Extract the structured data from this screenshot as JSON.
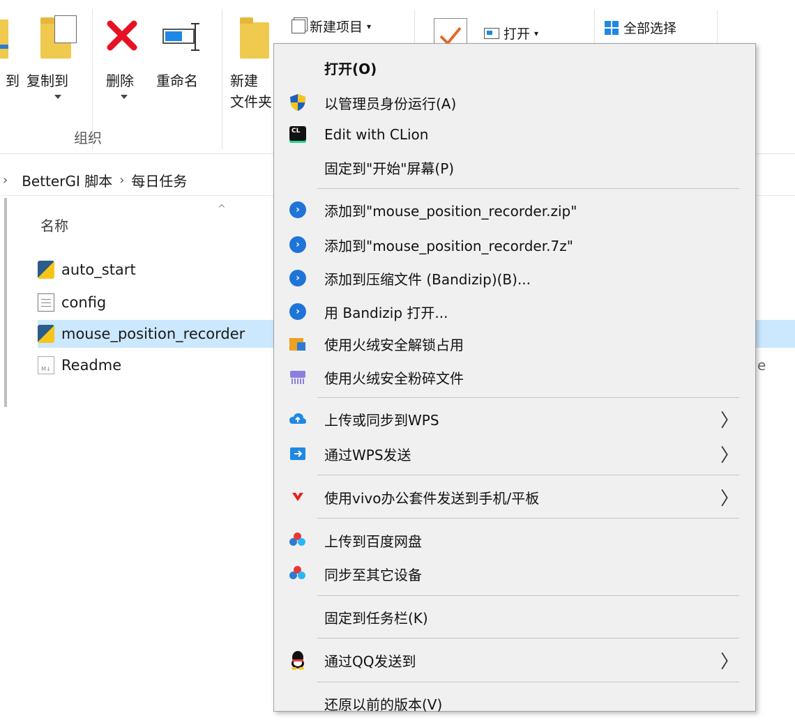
{
  "ribbon": {
    "move_to_partial": "到",
    "copy_to": "复制到",
    "delete": "删除",
    "rename": "重命名",
    "new_folder_line1": "新建",
    "new_folder_line2": "文件夹",
    "new_item": "新建项目",
    "open": "打开",
    "select_all": "全部选择",
    "group_organize": "组织"
  },
  "breadcrumb": {
    "items": [
      "BetterGI 脚本",
      "每日任务"
    ]
  },
  "file_list": {
    "column_name": "名称",
    "files": [
      {
        "name": "auto_start",
        "type": "python"
      },
      {
        "name": "config",
        "type": "text"
      },
      {
        "name": "mouse_position_recorder",
        "type": "python",
        "selected": true
      },
      {
        "name": "Readme",
        "type": "markdown"
      }
    ],
    "readme_type_tail": "e"
  },
  "context_menu": {
    "items": [
      {
        "label": "打开(O)",
        "bold": true,
        "icon": ""
      },
      {
        "label": "以管理员身份运行(A)",
        "icon": "uac-shield-icon"
      },
      {
        "label": "Edit with CLion",
        "icon": "clion-icon"
      },
      {
        "label": "固定到\"开始\"屏幕(P)",
        "icon": ""
      },
      {
        "label": "添加到\"mouse_position_recorder.zip\"",
        "icon": "bandizip-icon"
      },
      {
        "label": "添加到\"mouse_position_recorder.7z\"",
        "icon": "bandizip-icon"
      },
      {
        "label": "添加到压缩文件 (Bandizip)(B)...",
        "icon": "bandizip-icon"
      },
      {
        "label": "用 Bandizip 打开...",
        "icon": "bandizip-icon"
      },
      {
        "label": "使用火绒安全解锁占用",
        "icon": "huorong-unlock-icon"
      },
      {
        "label": "使用火绒安全粉碎文件",
        "icon": "huorong-shred-icon"
      },
      {
        "label": "上传或同步到WPS",
        "icon": "wps-cloud-icon",
        "submenu": true
      },
      {
        "label": "通过WPS发送",
        "icon": "wps-send-icon",
        "submenu": true
      },
      {
        "label": "使用vivo办公套件发送到手机/平板",
        "icon": "vivo-icon",
        "submenu": true
      },
      {
        "label": "上传到百度网盘",
        "icon": "baidu-netdisk-icon"
      },
      {
        "label": "同步至其它设备",
        "icon": "baidu-netdisk-icon"
      },
      {
        "label": "固定到任务栏(K)",
        "icon": ""
      },
      {
        "label": "通过QQ发送到",
        "icon": "qq-icon",
        "submenu": true
      },
      {
        "label": "还原以前的版本(V)",
        "icon": ""
      }
    ],
    "submenu_glyph": "〉"
  },
  "colors": {
    "selection": "#cce8ff",
    "menu_bg": "#f0f0f0",
    "delete_red": "#e81123",
    "folder_yellow": "#f0c94f"
  }
}
